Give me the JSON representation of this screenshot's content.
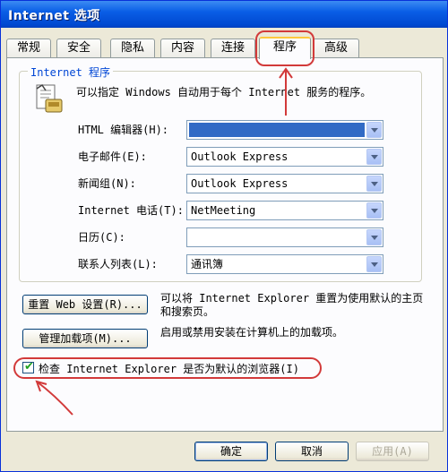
{
  "window": {
    "title": "Internet 选项"
  },
  "tabs": [
    {
      "label": "常规",
      "active": false
    },
    {
      "label": "安全",
      "active": false
    },
    {
      "label": "隐私",
      "active": false
    },
    {
      "label": "内容",
      "active": false
    },
    {
      "label": "连接",
      "active": false
    },
    {
      "label": "程序",
      "active": true
    },
    {
      "label": "高级",
      "active": false
    }
  ],
  "programs_group": {
    "label": "Internet 程序",
    "description": "可以指定 Windows 自动用于每个 Internet 服务的程序。",
    "icon": "programs-icon",
    "rows": [
      {
        "label": "HTML 编辑器(H):",
        "value": "",
        "highlighted": true
      },
      {
        "label": "电子邮件(E):",
        "value": "Outlook Express",
        "highlighted": false
      },
      {
        "label": "新闻组(N):",
        "value": "Outlook Express",
        "highlighted": false
      },
      {
        "label": "Internet 电话(T):",
        "value": "NetMeeting",
        "highlighted": false
      },
      {
        "label": "日历(C):",
        "value": "",
        "highlighted": false
      },
      {
        "label": "联系人列表(L):",
        "value": "通讯簿",
        "highlighted": false
      }
    ]
  },
  "reset": {
    "button_label": "重置 Web 设置(R)...",
    "text": "可以将 Internet Explorer 重置为使用默认的主页和搜索页。"
  },
  "addons": {
    "button_label": "管理加载项(M)...",
    "text": "启用或禁用安装在计算机上的加载项。"
  },
  "default_check": {
    "label": "检查 Internet Explorer 是否为默认的浏览器(I)",
    "checked": true
  },
  "footer": {
    "ok_label": "确定",
    "cancel_label": "取消",
    "apply_label": "应用(A)"
  },
  "colors": {
    "titlebar": "#0a5ee6",
    "selection": "#316ac5",
    "annotation": "#d23a3a",
    "group_label": "#0046d5"
  }
}
